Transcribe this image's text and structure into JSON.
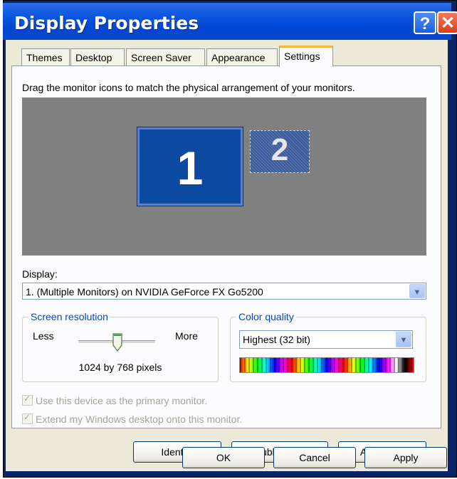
{
  "window": {
    "title": "Display Properties"
  },
  "titlebar": {
    "help_glyph": "?",
    "close_glyph": "✕"
  },
  "tabs": [
    {
      "label": "Themes"
    },
    {
      "label": "Desktop"
    },
    {
      "label": "Screen Saver"
    },
    {
      "label": "Appearance"
    },
    {
      "label": "Settings",
      "active": true
    }
  ],
  "settings": {
    "instruction": "Drag the monitor icons to match the physical arrangement of your monitors.",
    "monitors": [
      {
        "label": "1"
      },
      {
        "label": "2"
      }
    ],
    "display_label": "Display:",
    "display_value": "1. (Multiple Monitors) on NVIDIA GeForce FX Go5200",
    "screen_resolution": {
      "title": "Screen resolution",
      "less": "Less",
      "more": "More",
      "value_text": "1024 by 768 pixels"
    },
    "color_quality": {
      "title": "Color quality",
      "value": "Highest (32 bit)"
    },
    "checkboxes": [
      {
        "label": "Use this device as the primary monitor.",
        "checked": true,
        "enabled": false
      },
      {
        "label": "Extend my Windows desktop onto this monitor.",
        "checked": true,
        "enabled": false
      }
    ],
    "buttons": {
      "identify": "Identify",
      "troubleshoot": "Troubleshoot...",
      "advanced": "Advanced"
    }
  },
  "footer": {
    "ok": "OK",
    "cancel": "Cancel",
    "apply": "Apply"
  },
  "icons": {
    "dropdown": "chevron-down-icon",
    "help": "help-icon",
    "close": "close-icon"
  },
  "colors": {
    "titlebar": "#0054e3",
    "group_title": "#0046d5",
    "monitor_selected": "#0b4aa0",
    "desktop_area": "#808080"
  }
}
